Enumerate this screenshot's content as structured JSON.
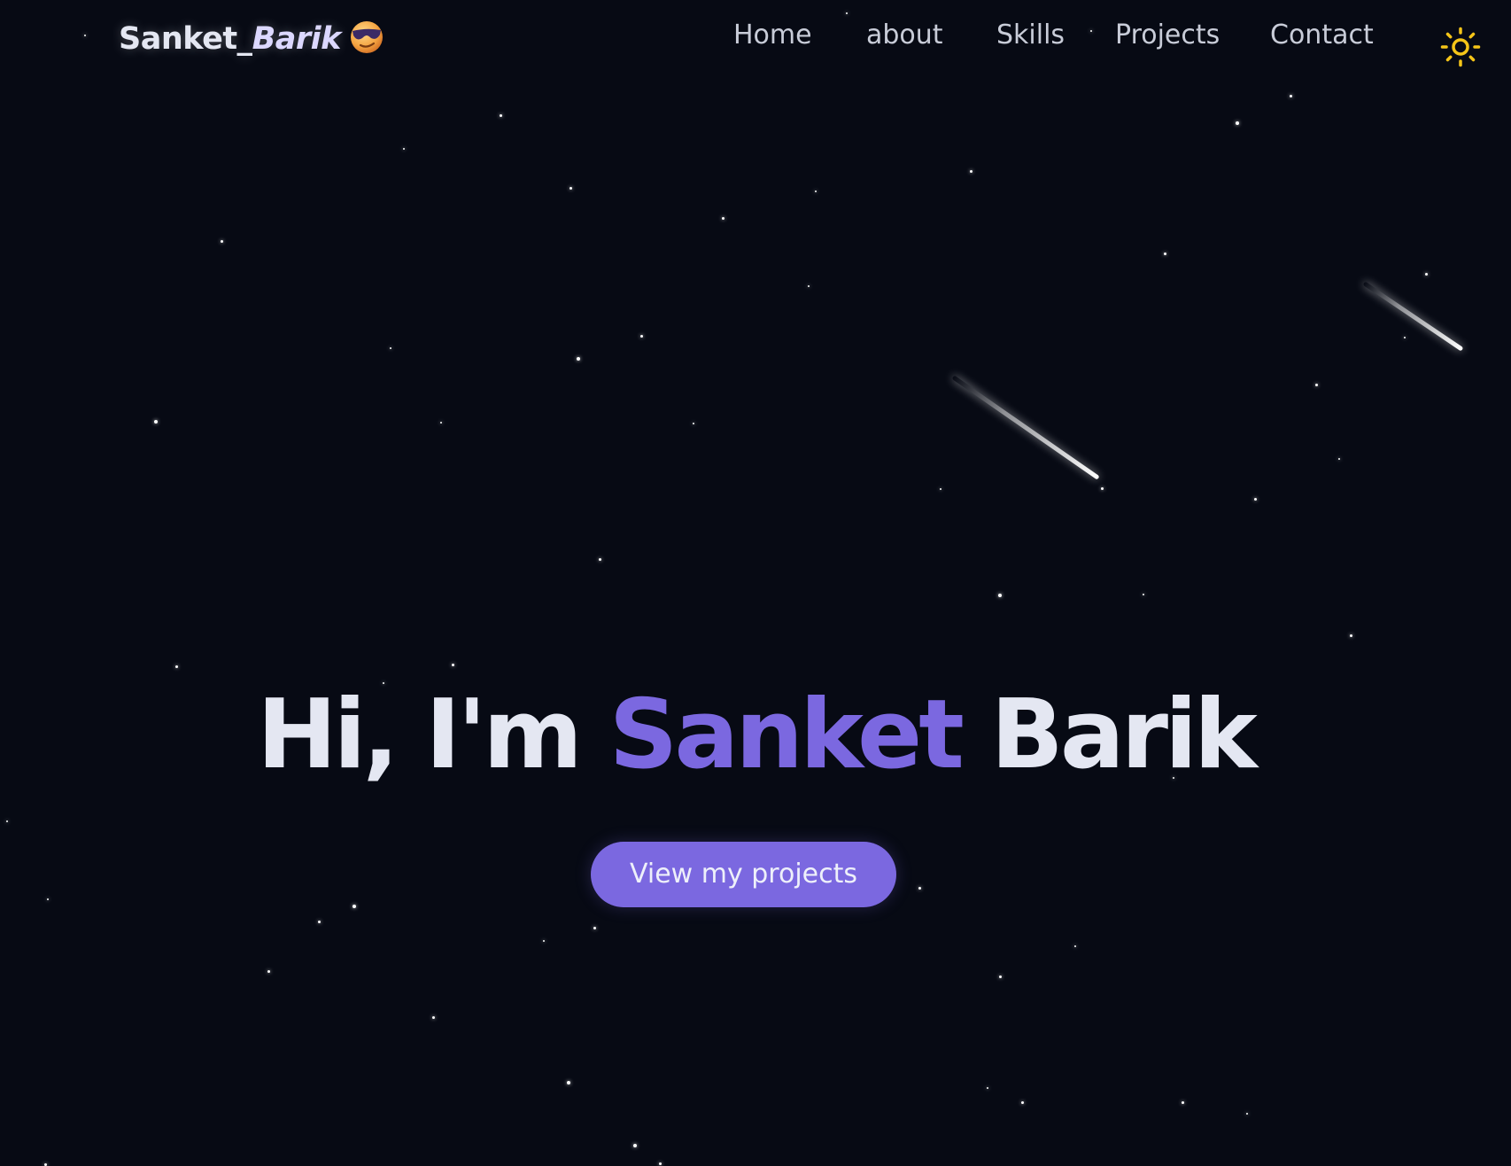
{
  "nav": {
    "logo_first": "Sanket_",
    "logo_second": "Barik",
    "logo_icon": "sunglasses-emoji-icon",
    "links": [
      {
        "label": "Home"
      },
      {
        "label": "about"
      },
      {
        "label": "Skills"
      },
      {
        "label": "Projects"
      },
      {
        "label": "Contact"
      }
    ],
    "theme_toggle_icon": "sun-icon"
  },
  "hero": {
    "greeting": "Hi, I'm",
    "first_name": "Sanket",
    "last_name": "Barik",
    "cta_label": "View my projects"
  },
  "theme": {
    "background": "#070a14",
    "accent": "#7b68e0",
    "text": "#e4e7f2",
    "nav_text": "#c8ccd8",
    "sun": "#f5c518"
  }
}
